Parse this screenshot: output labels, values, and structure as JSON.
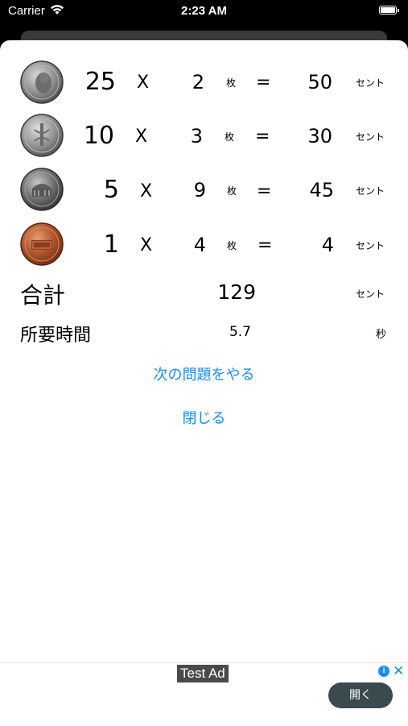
{
  "status_bar": {
    "carrier": "Carrier",
    "time": "2:23 AM"
  },
  "colors": {
    "link": "#1a8cff",
    "ad_button": "#3b4a4e"
  },
  "coins": [
    {
      "name": "quarter",
      "icon": "quarter-coin-icon",
      "value": "25",
      "operator": "X",
      "count": "2",
      "count_unit": "枚",
      "equals": "=",
      "result": "50",
      "result_unit": "セント"
    },
    {
      "name": "dime",
      "icon": "dime-coin-icon",
      "value": "10",
      "operator": "X",
      "count": "3",
      "count_unit": "枚",
      "equals": "=",
      "result": "30",
      "result_unit": "セント"
    },
    {
      "name": "nickel",
      "icon": "nickel-coin-icon",
      "value": "5",
      "operator": "X",
      "count": "9",
      "count_unit": "枚",
      "equals": "=",
      "result": "45",
      "result_unit": "セント"
    },
    {
      "name": "penny",
      "icon": "penny-coin-icon",
      "value": "1",
      "operator": "X",
      "count": "4",
      "count_unit": "枚",
      "equals": "=",
      "result": "4",
      "result_unit": "セント"
    }
  ],
  "total": {
    "label": "合計",
    "value": "129",
    "unit": "セント"
  },
  "time": {
    "label": "所要時間",
    "value": "5.7",
    "unit": "秒"
  },
  "actions": {
    "next": "次の問題をやる",
    "close": "閉じる"
  },
  "ad": {
    "badge": "Test Ad",
    "open": "開く",
    "close": "✕",
    "info": "i"
  }
}
